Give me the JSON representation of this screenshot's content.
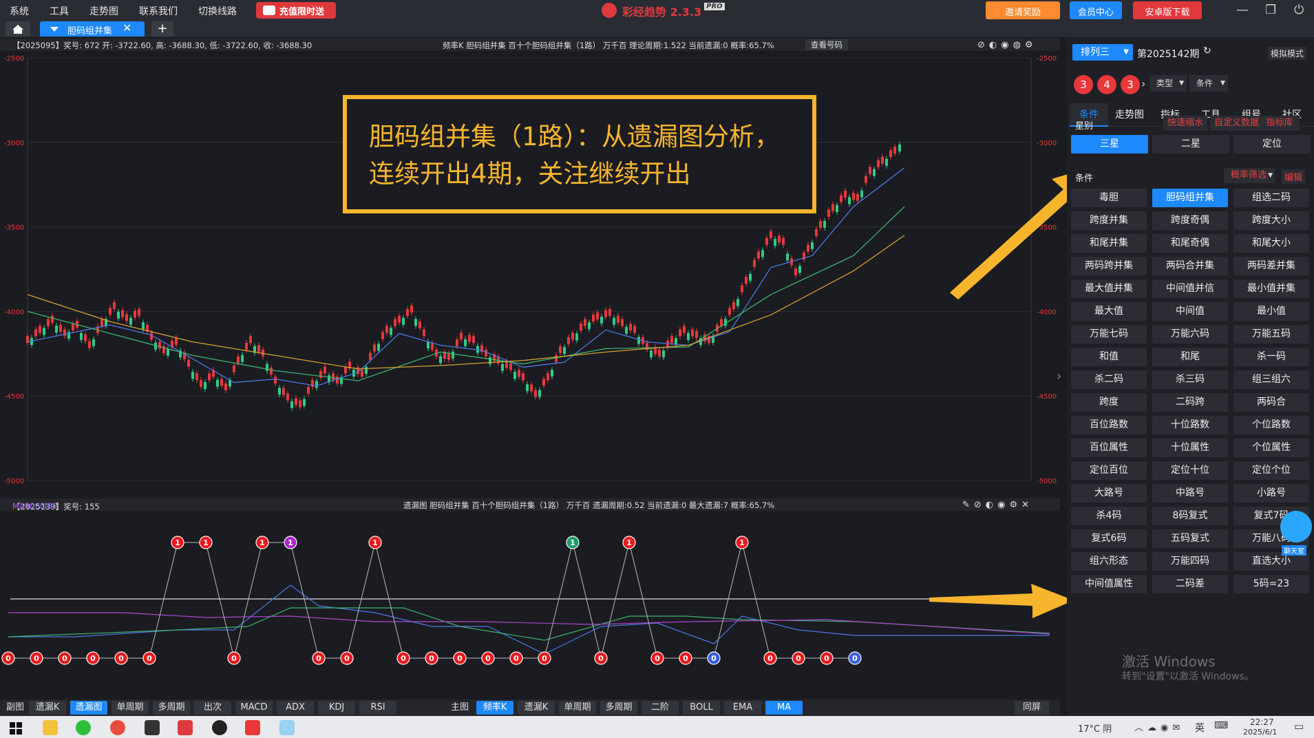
{
  "menu": {
    "items": [
      "系统",
      "工具",
      "走势图",
      "联系我们",
      "切换线路"
    ],
    "promo": "充值限时送"
  },
  "app_title": {
    "name": "彩经趋势 2.3.3",
    "badge": "PRO"
  },
  "top_buttons": {
    "invite": "邀请奖励",
    "member": "会员中心",
    "android": "安卓版下载"
  },
  "tab": {
    "active_label": "胆码组并集",
    "add": "+"
  },
  "main_info": {
    "left": "【2025095】奖号: 672  开: -3722.60, 高: -3688.30, 低: -3722.60, 收: -3688.30",
    "center": "频率K  胆码组并集  百十个胆码组并集（1路）  万千百  理论周期:1.522  当前遗漏:0  概率:65.7%",
    "view": "查看号码"
  },
  "sub_info": {
    "left_prefix": "【2025139】奖号: 155",
    "ma5": "MA5: 0.40",
    "ma10": "MA10: 0.30",
    "ma20": "MA20: 0.35",
    "center": "遗漏图  胆码组并集  百十个胆码组并集（1路）  万千百  遗漏周期:0.52  当前遗漏:0  最大遗漏:7  概率:65.7%"
  },
  "annotation": {
    "line1": "胆码组并集（1路）：从遗漏图分析，",
    "line2": "连续开出4期，关注继续开出"
  },
  "colors": {
    "accent": "#1e88ff",
    "annotation": "#f7b52d",
    "candle_red": "#e8383a",
    "ma5": "#4a78e8",
    "ma10": "#3cb371",
    "ma20": "#d4a030",
    "purple": "#b044d0"
  },
  "chart_data": [
    {
      "type": "line",
      "title": "频率K 胆码组并集",
      "ylim": [
        -5000,
        -2500
      ],
      "yticks": [
        "-2500",
        "-3000",
        "-3500",
        "-4000",
        "-4500",
        "-5000"
      ],
      "series": [
        {
          "name": "K线",
          "points": [
            [
              0,
              -4180
            ],
            [
              18,
              -4120
            ],
            [
              36,
              -4060
            ],
            [
              54,
              -4140
            ],
            [
              72,
              -4090
            ],
            [
              90,
              -4210
            ],
            [
              108,
              -4080
            ],
            [
              126,
              -3980
            ],
            [
              144,
              -4050
            ],
            [
              162,
              -4020
            ],
            [
              180,
              -4160
            ],
            [
              198,
              -4240
            ],
            [
              216,
              -4190
            ],
            [
              234,
              -4320
            ],
            [
              252,
              -4440
            ],
            [
              270,
              -4380
            ],
            [
              288,
              -4460
            ],
            [
              306,
              -4300
            ],
            [
              324,
              -4180
            ],
            [
              342,
              -4260
            ],
            [
              360,
              -4420
            ],
            [
              378,
              -4520
            ],
            [
              396,
              -4560
            ],
            [
              414,
              -4440
            ],
            [
              432,
              -4360
            ],
            [
              450,
              -4420
            ],
            [
              468,
              -4330
            ],
            [
              486,
              -4380
            ],
            [
              504,
              -4230
            ],
            [
              522,
              -4120
            ],
            [
              540,
              -4060
            ],
            [
              558,
              -4000
            ],
            [
              576,
              -4140
            ],
            [
              594,
              -4260
            ],
            [
              612,
              -4280
            ],
            [
              630,
              -4160
            ],
            [
              648,
              -4180
            ],
            [
              666,
              -4260
            ],
            [
              684,
              -4300
            ],
            [
              702,
              -4340
            ],
            [
              720,
              -4400
            ],
            [
              738,
              -4500
            ],
            [
              756,
              -4400
            ],
            [
              774,
              -4240
            ],
            [
              792,
              -4160
            ],
            [
              810,
              -4080
            ],
            [
              828,
              -4040
            ],
            [
              846,
              -4020
            ],
            [
              864,
              -4080
            ],
            [
              882,
              -4120
            ],
            [
              900,
              -4220
            ],
            [
              918,
              -4260
            ],
            [
              936,
              -4180
            ],
            [
              954,
              -4120
            ],
            [
              972,
              -4150
            ],
            [
              990,
              -4180
            ],
            [
              1008,
              -4080
            ],
            [
              1026,
              -3980
            ],
            [
              1044,
              -3830
            ],
            [
              1062,
              -3680
            ],
            [
              1080,
              -3560
            ],
            [
              1098,
              -3600
            ],
            [
              1116,
              -3780
            ],
            [
              1134,
              -3640
            ],
            [
              1152,
              -3500
            ],
            [
              1170,
              -3400
            ],
            [
              1188,
              -3320
            ],
            [
              1206,
              -3340
            ],
            [
              1224,
              -3180
            ],
            [
              1242,
              -3120
            ],
            [
              1260,
              -3060
            ],
            [
              1274,
              -2970
            ]
          ]
        },
        {
          "name": "MA5",
          "points": [
            [
              0,
              -4180
            ],
            [
              60,
              -4130
            ],
            [
              120,
              -4080
            ],
            [
              180,
              -4140
            ],
            [
              240,
              -4280
            ],
            [
              300,
              -4420
            ],
            [
              360,
              -4400
            ],
            [
              420,
              -4440
            ],
            [
              480,
              -4360
            ],
            [
              540,
              -4130
            ],
            [
              600,
              -4200
            ],
            [
              660,
              -4230
            ],
            [
              720,
              -4330
            ],
            [
              780,
              -4300
            ],
            [
              840,
              -4110
            ],
            [
              900,
              -4180
            ],
            [
              960,
              -4200
            ],
            [
              1020,
              -4120
            ],
            [
              1080,
              -3740
            ],
            [
              1140,
              -3670
            ],
            [
              1200,
              -3380
            ],
            [
              1274,
              -3150
            ]
          ]
        },
        {
          "name": "MA10",
          "points": [
            [
              0,
              -4000
            ],
            [
              120,
              -4130
            ],
            [
              240,
              -4260
            ],
            [
              360,
              -4350
            ],
            [
              480,
              -4410
            ],
            [
              600,
              -4240
            ],
            [
              720,
              -4310
            ],
            [
              840,
              -4220
            ],
            [
              960,
              -4210
            ],
            [
              1080,
              -3900
            ],
            [
              1200,
              -3670
            ],
            [
              1274,
              -3380
            ]
          ]
        },
        {
          "name": "MA20",
          "points": [
            [
              0,
              -3900
            ],
            [
              120,
              -4060
            ],
            [
              240,
              -4180
            ],
            [
              360,
              -4260
            ],
            [
              480,
              -4340
            ],
            [
              600,
              -4320
            ],
            [
              720,
              -4290
            ],
            [
              840,
              -4240
            ],
            [
              960,
              -4200
            ],
            [
              1080,
              -4020
            ],
            [
              1200,
              -3760
            ],
            [
              1274,
              -3550
            ]
          ]
        }
      ]
    },
    {
      "type": "scatter",
      "title": "遗漏图",
      "x": [
        12,
        53,
        94,
        135,
        176,
        217,
        258,
        299,
        340,
        381,
        422,
        463,
        504,
        545,
        586,
        627,
        668,
        709,
        750,
        791,
        832,
        873,
        914,
        955,
        996,
        1037,
        1078,
        1119,
        1160,
        1201,
        1242
      ],
      "values": [
        0,
        0,
        0,
        0,
        0,
        0,
        1,
        1,
        0,
        1,
        1,
        0,
        0,
        1,
        0,
        0,
        0,
        0,
        0,
        0,
        1,
        0,
        1,
        0,
        0,
        0,
        1,
        0,
        0,
        0,
        0
      ],
      "marker_colors": [
        "red",
        "red",
        "red",
        "red",
        "red",
        "red",
        "red",
        "red",
        "red",
        "red",
        "purple",
        "red",
        "red",
        "red",
        "red",
        "red",
        "red",
        "red",
        "red",
        "red",
        "green",
        "red",
        "red",
        "red",
        "red",
        "blue",
        "red",
        "red",
        "red",
        "red",
        "blue"
      ]
    }
  ],
  "bottom_bar": {
    "left_label": "副图",
    "left": [
      "遗漏K",
      "遗漏图",
      "单周期",
      "多周期",
      "出次",
      "MACD",
      "ADX",
      "KDJ",
      "RSI"
    ],
    "left_active": "遗漏图",
    "mid_label": "主图",
    "mid": [
      "频率K",
      "遗漏K",
      "单周期",
      "多周期",
      "二阶",
      "BOLL",
      "EMA",
      "MA"
    ],
    "mid_active": [
      "频率K",
      "MA"
    ],
    "right": "同屏"
  },
  "right_panel": {
    "lottery_select": "排列三",
    "issue": "第2025142期",
    "sim": "模拟模式",
    "balls": [
      "3",
      "4",
      "3"
    ],
    "type_select": "类型",
    "cond_select": "条件",
    "tabs": [
      "条件",
      "走势图",
      "指标",
      "工具",
      "组号",
      "社区"
    ],
    "star_label": "星别",
    "star_links": [
      "快速缩水",
      "自定义数据",
      "指标库"
    ],
    "star_opts": [
      "三星",
      "二星",
      "定位"
    ],
    "cond_label": "条件",
    "cond_filter": "概率筛选",
    "cond_edit": "编辑",
    "grid": [
      "毒胆",
      "胆码组并集",
      "组选二码",
      "跨度并集",
      "跨度奇偶",
      "跨度大小",
      "和尾并集",
      "和尾奇偶",
      "和尾大小",
      "两码跨并集",
      "两码合并集",
      "两码差并集",
      "最大值并集",
      "中间值并信",
      "最小值并集",
      "最大值",
      "中间值",
      "最小值",
      "万能七码",
      "万能六码",
      "万能五码",
      "和值",
      "和尾",
      "杀一码",
      "杀二码",
      "杀三码",
      "组三组六",
      "跨度",
      "二码跨",
      "两码合",
      "百位路数",
      "十位路数",
      "个位路数",
      "百位属性",
      "十位属性",
      "个位属性",
      "定位百位",
      "定位十位",
      "定位个位",
      "大路号",
      "中路号",
      "小路号",
      "杀4码",
      "8码复式",
      "复式7码",
      "复式6码",
      "五码复式",
      "万能八码",
      "组六形态",
      "万能四码",
      "直选大小",
      "中间值属性",
      "二码差",
      "5码=23"
    ],
    "grid_active": "胆码组并集",
    "chat": "聊天室"
  },
  "watermark": {
    "line1": "激活 Windows",
    "line2": "转到\"设置\"以激活 Windows。"
  },
  "taskbar": {
    "weather": "17°C 阴",
    "ime": "英",
    "time": "22:27",
    "date": "2025/6/1"
  }
}
